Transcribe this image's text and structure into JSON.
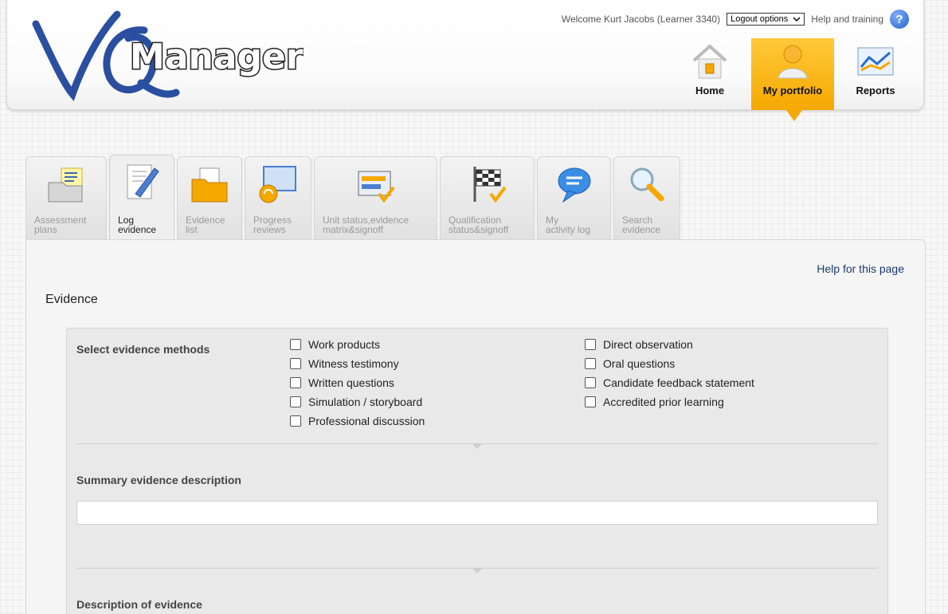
{
  "header": {
    "logo_text": "VQManager",
    "welcome": "Welcome Kurt Jacobs (Learner 3340)",
    "logout_label": "Logout options",
    "help_label": "Help and training",
    "help_glyph": "?"
  },
  "mainnav": [
    {
      "label": "Home",
      "icon": "home-icon",
      "active": false
    },
    {
      "label": "My portfolio",
      "icon": "user-icon",
      "active": true
    },
    {
      "label": "Reports",
      "icon": "chart-icon",
      "active": false
    }
  ],
  "tabs": [
    {
      "label": "Assessment\nplans",
      "icon": "folder-checklist-icon"
    },
    {
      "label": "Log\nevidence",
      "icon": "document-pen-icon",
      "active": true
    },
    {
      "label": "Evidence\nlist",
      "icon": "folder-icon"
    },
    {
      "label": "Progress\nreviews",
      "icon": "reviews-icon"
    },
    {
      "label": "Unit status,evidence\nmatrix&signoff",
      "icon": "window-check-icon"
    },
    {
      "label": "Qualification\nstatus&signoff",
      "icon": "checkered-flag-icon"
    },
    {
      "label": "My\nactivity log",
      "icon": "speech-bubble-icon"
    },
    {
      "label": "Search\nevidence",
      "icon": "magnifier-icon"
    }
  ],
  "page": {
    "help_link": "Help for this page",
    "title": "Evidence"
  },
  "form": {
    "methods_label": "Select evidence methods",
    "methods_left": [
      "Work products",
      "Witness testimony",
      "Written questions",
      "Simulation / storyboard",
      "Professional discussion"
    ],
    "methods_right": [
      "Direct observation",
      "Oral questions",
      "Candidate feedback statement",
      "Accredited prior learning"
    ],
    "summary_label": "Summary evidence description",
    "summary_value": "",
    "description_label": "Description of evidence"
  },
  "colors": {
    "active_nav": "#f5a800",
    "link": "#1a3a6b",
    "logo_blue": "#2a4fa0"
  }
}
